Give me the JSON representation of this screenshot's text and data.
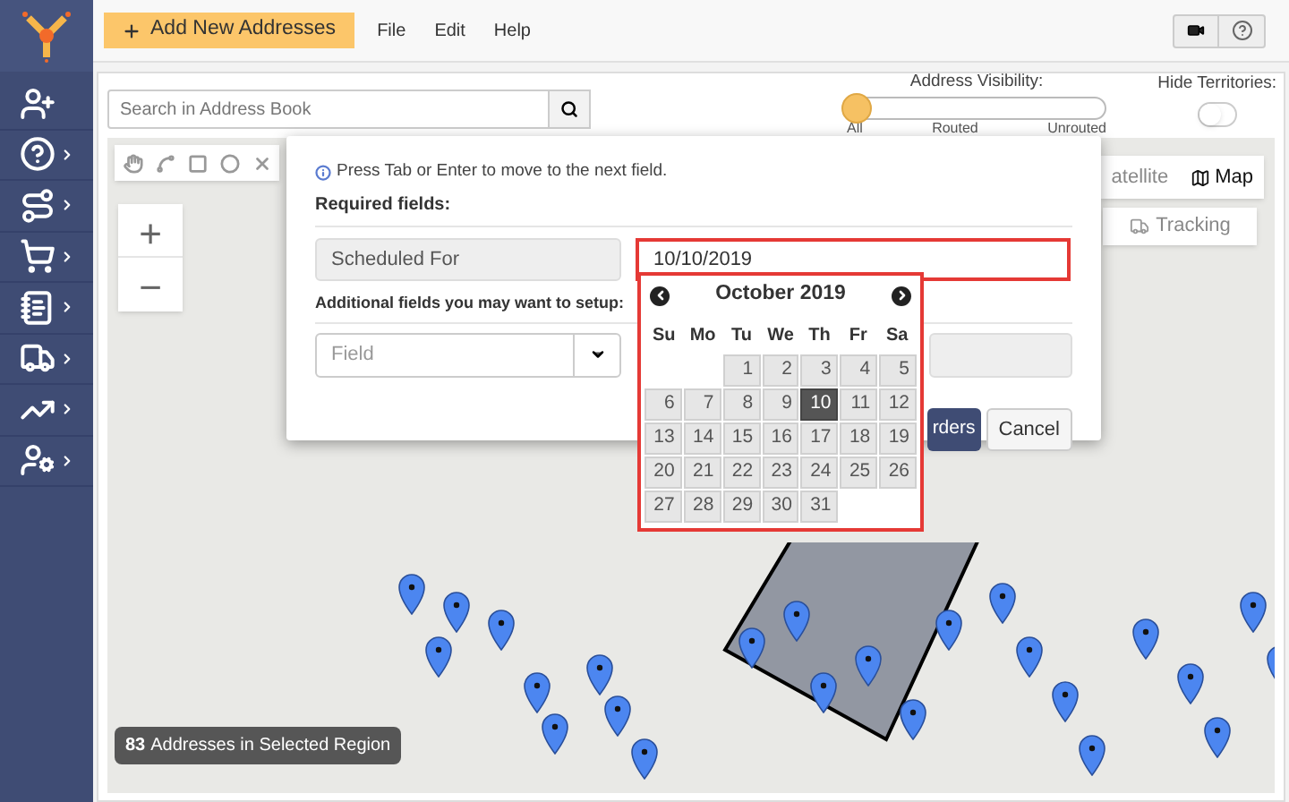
{
  "sidebar": {
    "items": [
      {
        "kind": "add-user",
        "submenu": false
      },
      {
        "kind": "help",
        "submenu": true
      },
      {
        "kind": "routes",
        "submenu": true
      },
      {
        "kind": "cart",
        "submenu": true
      },
      {
        "kind": "notebook",
        "submenu": true
      },
      {
        "kind": "fleet",
        "submenu": true
      },
      {
        "kind": "chart",
        "submenu": true
      },
      {
        "kind": "user-settings",
        "submenu": true
      }
    ]
  },
  "toolbar": {
    "primary_button": "Add New Addresses",
    "menu": [
      "File",
      "Edit",
      "Help"
    ]
  },
  "search": {
    "placeholder": "Search in Address Book"
  },
  "address_visibility": {
    "label": "Address Visibility:",
    "level": 0,
    "stops": [
      "All",
      "Routed",
      "Unrouted"
    ]
  },
  "hide_territories": {
    "label": "Hide Territories:",
    "on": false
  },
  "map": {
    "map_types": [
      {
        "label": "atellite",
        "selected": false
      },
      {
        "label": "Map",
        "selected": true
      }
    ],
    "tracking_button": "Tracking",
    "zoom_in": "+",
    "zoom_out": "−",
    "selection_count": "83",
    "selection_label": "Addresses in Selected Region"
  },
  "dialog": {
    "hint": "Press Tab or Enter to move to the next field.",
    "required_title": "Required fields:",
    "required_field": {
      "label": "Scheduled For",
      "value": "10/10/2019"
    },
    "additional_title": "Additional fields you may want to setup:",
    "field_select": {
      "placeholder": "Field"
    },
    "buttons": [
      {
        "label": "rders",
        "kind": "primary"
      },
      {
        "label": "Cancel",
        "kind": "default"
      }
    ]
  },
  "calendar": {
    "month": "October 2019",
    "weekdays": [
      "Su",
      "Mo",
      "Tu",
      "We",
      "Th",
      "Fr",
      "Sa"
    ],
    "weeks": [
      [
        {
          "label": "1",
          "selected": false
        },
        {
          "label": "2",
          "selected": false
        },
        {
          "label": "3",
          "selected": false
        },
        {
          "label": "4",
          "selected": false
        },
        {
          "label": "5",
          "selected": false
        }
      ],
      [
        {
          "label": "6",
          "selected": false
        },
        {
          "label": "7",
          "selected": false
        },
        {
          "label": "8",
          "selected": false
        },
        {
          "label": "9",
          "selected": false
        },
        {
          "label": "10",
          "selected": true
        },
        {
          "label": "11",
          "selected": false
        },
        {
          "label": "12",
          "selected": false
        }
      ],
      [
        {
          "label": "13",
          "selected": false
        },
        {
          "label": "14",
          "selected": false
        },
        {
          "label": "15",
          "selected": false
        },
        {
          "label": "16",
          "selected": false
        },
        {
          "label": "17",
          "selected": false
        },
        {
          "label": "18",
          "selected": false
        },
        {
          "label": "19",
          "selected": false
        }
      ],
      [
        {
          "label": "20",
          "selected": false
        },
        {
          "label": "21",
          "selected": false
        },
        {
          "label": "22",
          "selected": false
        },
        {
          "label": "23",
          "selected": false
        },
        {
          "label": "24",
          "selected": false
        },
        {
          "label": "25",
          "selected": false
        },
        {
          "label": "26",
          "selected": false
        }
      ],
      [
        {
          "label": "27",
          "selected": false
        },
        {
          "label": "28",
          "selected": false
        },
        {
          "label": "29",
          "selected": false
        },
        {
          "label": "30",
          "selected": false
        },
        {
          "label": "31",
          "selected": false
        }
      ]
    ]
  }
}
